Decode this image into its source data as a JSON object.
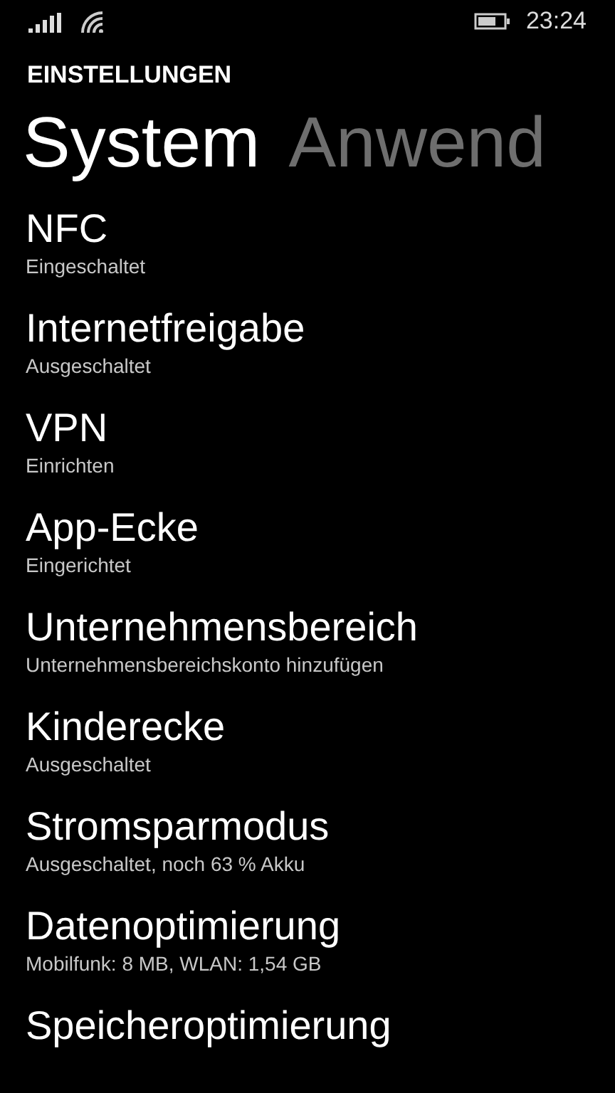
{
  "status_bar": {
    "time": "23:24"
  },
  "app_title": "EINSTELLUNGEN",
  "pivots": [
    {
      "label": "System",
      "selected": true
    },
    {
      "label": "Anwend",
      "selected": false
    }
  ],
  "items": [
    {
      "title": "NFC",
      "subtitle": "Eingeschaltet"
    },
    {
      "title": "Internetfreigabe",
      "subtitle": "Ausgeschaltet"
    },
    {
      "title": "VPN",
      "subtitle": "Einrichten"
    },
    {
      "title": "App-Ecke",
      "subtitle": "Eingerichtet"
    },
    {
      "title": "Unternehmensbereich",
      "subtitle": "Unternehmensbereichskonto hinzufügen"
    },
    {
      "title": "Kinderecke",
      "subtitle": "Ausgeschaltet"
    },
    {
      "title": "Stromsparmodus",
      "subtitle": "Ausgeschaltet, noch 63 % Akku"
    },
    {
      "title": "Datenoptimierung",
      "subtitle": "Mobilfunk: 8 MB, WLAN: 1,54 GB"
    },
    {
      "title": "Speicheroptimierung"
    }
  ]
}
